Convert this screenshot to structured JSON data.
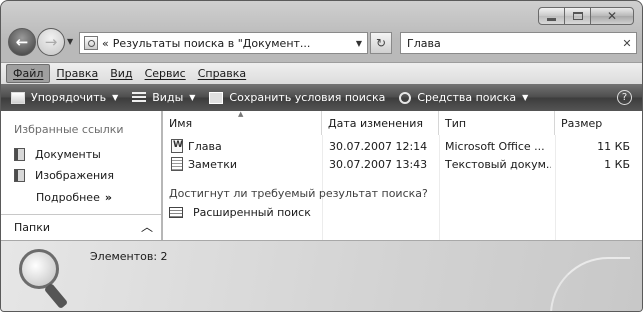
{
  "window": {
    "address_text": "Результаты поиска в \"Документ...",
    "address_chevron": "«",
    "search_value": "Глава"
  },
  "menu": [
    {
      "label": "Файл"
    },
    {
      "label": "Правка"
    },
    {
      "label": "Вид"
    },
    {
      "label": "Сервис"
    },
    {
      "label": "Справка"
    }
  ],
  "toolbar": {
    "organize": "Упорядочить",
    "views": "Виды",
    "save_search": "Сохранить условия поиска",
    "search_tools": "Средства поиска",
    "help": "?"
  },
  "nav": {
    "title": "Избранные ссылки",
    "links": [
      {
        "label": "Документы",
        "icon": "documents-icon"
      },
      {
        "label": "Изображения",
        "icon": "pictures-icon"
      }
    ],
    "more": "Подробнее",
    "more_glyph": "»",
    "folders": "Папки"
  },
  "columns": [
    "Имя",
    "Дата изменения",
    "Тип",
    "Размер"
  ],
  "files": [
    {
      "name": "Глава",
      "date": "30.07.2007 12:14",
      "type": "Microsoft Office ...",
      "size": "11 КБ",
      "icon": "word-document-icon"
    },
    {
      "name": "Заметки",
      "date": "30.07.2007 13:43",
      "type": "Текстовый докум...",
      "size": "1 КБ",
      "icon": "text-document-icon"
    }
  ],
  "search_prompt": "Достигнут ли требуемый результат поиска?",
  "advanced_search": "Расширенный поиск",
  "status": {
    "count_text": "Элементов: 2"
  }
}
